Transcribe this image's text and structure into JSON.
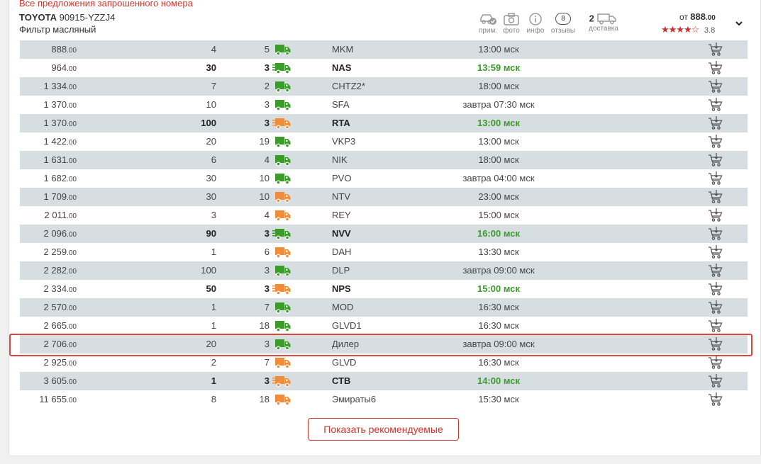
{
  "header": {
    "all_offers_link": "Все предложения запрошенного номера",
    "brand": "TOYOTA",
    "part_number": "90915-YZZJ4",
    "part_name": "Фильтр масляный",
    "icons": [
      {
        "name": "car-check-icon",
        "label": "прим."
      },
      {
        "name": "camera-icon",
        "label": "фото"
      },
      {
        "name": "info-icon",
        "label": "инфо"
      },
      {
        "name": "reviews-icon",
        "label": "отзывы",
        "badge": "8"
      }
    ],
    "delivery": {
      "count": "2",
      "label": "доставка"
    },
    "price_from_prefix": "от",
    "price_from_main": "888",
    "price_from_cents": ".00",
    "rating": {
      "value": "3.8",
      "filled_stars": 4,
      "star_color": "#c9302c"
    }
  },
  "colors": {
    "truck_green": "#3b9c2a",
    "truck_orange": "#ef8d3a",
    "accent_red": "#d0342c",
    "row_alt": "#d6dee2"
  },
  "offers": [
    {
      "price": "888",
      "cents": ".00",
      "qty": "4",
      "days": "5",
      "truck": "green",
      "fast": false,
      "supplier": "MKM",
      "time": "13:00 мск",
      "bold": false
    },
    {
      "price": "964",
      "cents": ".00",
      "qty": "30",
      "days": "3",
      "truck": "green",
      "fast": true,
      "supplier": "NAS",
      "time": "13:59 мск",
      "bold": true
    },
    {
      "price": "1 334",
      "cents": ".00",
      "qty": "7",
      "days": "2",
      "truck": "green",
      "fast": false,
      "supplier": "CHTZ2*",
      "time": "18:00 мск",
      "bold": false
    },
    {
      "price": "1 370",
      "cents": ".00",
      "qty": "10",
      "days": "3",
      "truck": "green",
      "fast": false,
      "supplier": "SFA",
      "time": "завтра 07:30 мск",
      "bold": false
    },
    {
      "price": "1 370",
      "cents": ".00",
      "qty": "100",
      "days": "3",
      "truck": "orange",
      "fast": true,
      "supplier": "RTA",
      "time": "13:00 мск",
      "bold": true
    },
    {
      "price": "1 422",
      "cents": ".00",
      "qty": "20",
      "days": "19",
      "truck": "green",
      "fast": false,
      "supplier": "VKP3",
      "time": "13:00 мск",
      "bold": false
    },
    {
      "price": "1 631",
      "cents": ".00",
      "qty": "6",
      "days": "4",
      "truck": "green",
      "fast": false,
      "supplier": "NIK",
      "time": "18:00 мск",
      "bold": false
    },
    {
      "price": "1 682",
      "cents": ".00",
      "qty": "30",
      "days": "10",
      "truck": "green",
      "fast": false,
      "supplier": "PVO",
      "time": "завтра 04:00 мск",
      "bold": false
    },
    {
      "price": "1 709",
      "cents": ".00",
      "qty": "30",
      "days": "10",
      "truck": "orange",
      "fast": false,
      "supplier": "NTV",
      "time": "23:00 мск",
      "bold": false
    },
    {
      "price": "2 011",
      "cents": ".00",
      "qty": "3",
      "days": "4",
      "truck": "orange",
      "fast": false,
      "supplier": "REY",
      "time": "15:00 мск",
      "bold": false
    },
    {
      "price": "2 096",
      "cents": ".00",
      "qty": "90",
      "days": "3",
      "truck": "green",
      "fast": true,
      "supplier": "NVV",
      "time": "16:00 мск",
      "bold": true
    },
    {
      "price": "2 259",
      "cents": ".00",
      "qty": "1",
      "days": "6",
      "truck": "orange",
      "fast": false,
      "supplier": "DAH",
      "time": "13:30 мск",
      "bold": false
    },
    {
      "price": "2 282",
      "cents": ".00",
      "qty": "100",
      "days": "3",
      "truck": "green",
      "fast": false,
      "supplier": "DLP",
      "time": "завтра 09:00 мск",
      "bold": false
    },
    {
      "price": "2 334",
      "cents": ".00",
      "qty": "50",
      "days": "3",
      "truck": "orange",
      "fast": true,
      "supplier": "NPS",
      "time": "15:00 мск",
      "bold": true
    },
    {
      "price": "2 570",
      "cents": ".00",
      "qty": "1",
      "days": "7",
      "truck": "green",
      "fast": false,
      "supplier": "MOD",
      "time": "16:30 мск",
      "bold": false
    },
    {
      "price": "2 665",
      "cents": ".00",
      "qty": "1",
      "days": "18",
      "truck": "green",
      "fast": false,
      "supplier": "GLVD1",
      "time": "16:30 мск",
      "bold": false
    },
    {
      "price": "2 706",
      "cents": ".00",
      "qty": "20",
      "days": "3",
      "truck": "green",
      "fast": false,
      "supplier": "Дилер",
      "time": "завтра 09:00 мск",
      "bold": false,
      "selected": true
    },
    {
      "price": "2 925",
      "cents": ".00",
      "qty": "2",
      "days": "7",
      "truck": "orange",
      "fast": false,
      "supplier": "GLVD",
      "time": "16:30 мск",
      "bold": false
    },
    {
      "price": "3 605",
      "cents": ".00",
      "qty": "1",
      "days": "3",
      "truck": "orange",
      "fast": true,
      "supplier": "СТВ",
      "time": "14:00 мск",
      "bold": true
    },
    {
      "price": "11 655",
      "cents": ".00",
      "qty": "8",
      "days": "18",
      "truck": "orange",
      "fast": false,
      "supplier": "Эмираты6",
      "time": "15:30 мск",
      "bold": false
    }
  ],
  "show_recommended_label": "Показать рекомендуемые"
}
